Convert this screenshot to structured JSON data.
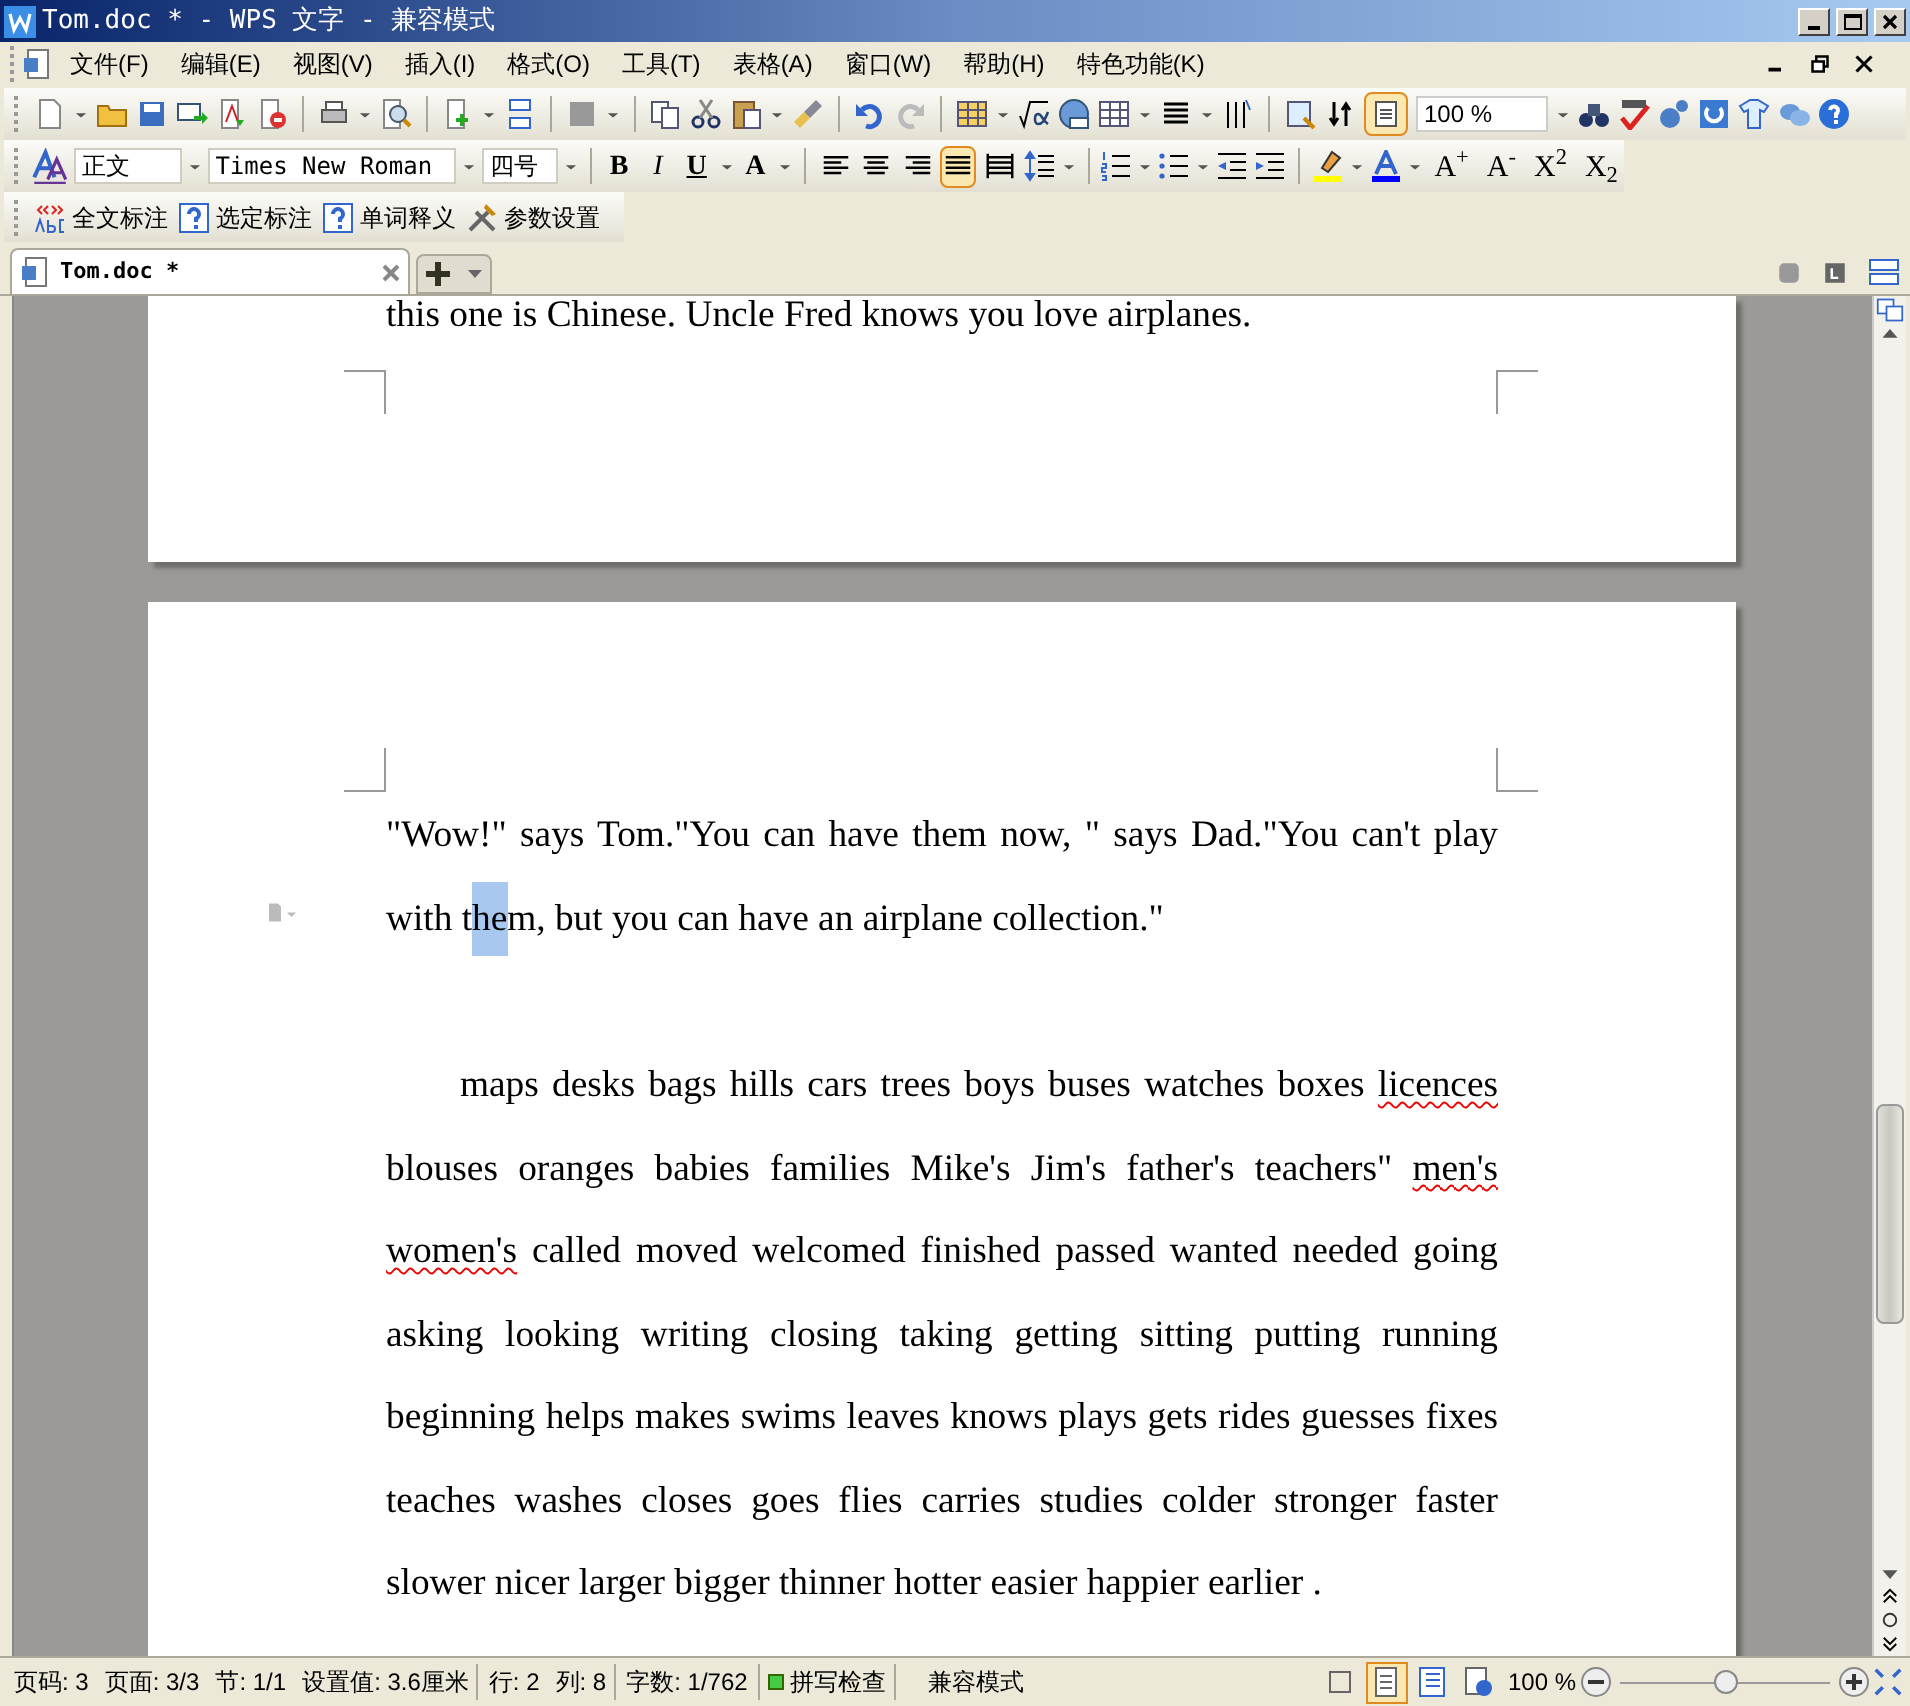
{
  "window": {
    "title": "Tom.doc * - WPS 文字 - 兼容模式"
  },
  "menu": [
    "文件(F)",
    "编辑(E)",
    "视图(V)",
    "插入(I)",
    "格式(O)",
    "工具(T)",
    "表格(A)",
    "窗口(W)",
    "帮助(H)",
    "特色功能(K)"
  ],
  "standard_toolbar": {
    "zoom": "100 %",
    "page_frame_active": true
  },
  "format_toolbar": {
    "style": "正文",
    "font": "Times New Roman",
    "size": "四号",
    "buttons": [
      {
        "label": "B",
        "kind": "bold"
      },
      {
        "label": "I",
        "kind": "italic"
      },
      {
        "label": "U",
        "kind": "underline"
      },
      {
        "label": "A",
        "kind": "effect"
      }
    ],
    "alignment": [
      {
        "selected": false
      },
      {
        "selected": false
      },
      {
        "selected": false
      },
      {
        "selected": true
      },
      {
        "selected": false
      }
    ],
    "size_buttons": [
      {
        "label": "A$^{+}$"
      },
      {
        "label": "A$^{-}$"
      },
      {
        "label": "X$^{2}$"
      },
      {
        "label": "X$_{2}$"
      }
    ]
  },
  "annotation_toolbar": [
    {
      "label": "全文标注",
      "kind": "abc"
    },
    {
      "label": "选定标注",
      "kind": "help"
    },
    {
      "label": "单词释义",
      "kind": "help"
    },
    {
      "label": "参数设置",
      "kind": "tools"
    }
  ],
  "tabs": [
    {
      "label": "Tom.doc *",
      "selected": true
    }
  ],
  "document": {
    "previous_page_tail": "this one is Chinese. Uncle Fred knows you love airplanes.",
    "paragraphs": [
      {
        "indent": false,
        "segments": [
          {
            "text": "\"Wow!\" says Tom.\"You can have them now, \" says Dad.\"You can't play with t",
            "kind": "plain"
          },
          {
            "text": "he",
            "kind": "selected"
          },
          {
            "text": "m, but you can have an airplane collection.\"",
            "kind": "plain"
          }
        ]
      },
      {
        "indent": true,
        "segments": [
          {
            "text": "maps desks bags hills cars trees boys buses watches boxes ",
            "kind": "plain"
          },
          {
            "text": "licences",
            "kind": "misspelled"
          },
          {
            "text": " blouses oranges babies families Mike's Jim's father's teachers\" ",
            "kind": "plain"
          },
          {
            "text": "men's",
            "kind": "misspelled"
          },
          {
            "text": " women's",
            "kind": "misspelled"
          },
          {
            "text": " called moved welcomed finished passed wanted needed going asking looking writing closing taking getting sitting putting running beginning helps makes swims leaves knows plays gets rides guesses fixes teaches washes closes goes flies carries studies colder stronger faster slower nicer larger bigger thinner hotter easier happier earlier .",
            "kind": "plain"
          }
        ]
      }
    ]
  },
  "status_bar": {
    "items": [
      "页码: 3",
      "页面: 3/3",
      "节: 1/1",
      "设置值: 3.6厘米",
      "行: 2",
      "列: 8",
      "字数: 1/762"
    ],
    "spell_check": {
      "label": "拼写检查",
      "on": true
    },
    "mode": "兼容模式",
    "views": [
      {
        "selected": false
      },
      {
        "selected": true
      },
      {
        "selected": false
      },
      {
        "selected": false
      }
    ],
    "zoom": "100 %",
    "zoom_level": {
      "level": 0.5
    }
  }
}
